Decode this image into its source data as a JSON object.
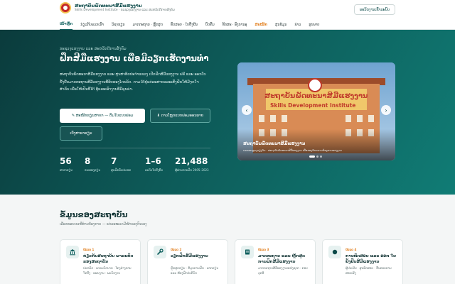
{
  "brand": {
    "title": "ສະຖາບັນພັດທະນາສີມືແຮງງານ",
    "subtitle": "Skills Development Institute · ກະຊວງແຮງງານ ແລະ ສະຫວັດດີການສັງຄົມ"
  },
  "header": {
    "login_label": "ພະນັກງານເຂົ້າລະບົບ"
  },
  "nav": {
    "items": [
      "ໜ້າຫຼັກ",
      "ກ່ຽວກັບພວກເຮົາ",
      "ວິຊາຮຽນ",
      "ມາດຕະຖານ · ຫຼັກສູດ",
      "ທົດສອບ · ໃບຢັ້ງຢືນ",
      "ບົດຄົ້ນ",
      "ທັກສະ · ອົງການອຸ",
      "ສະໝັກ",
      "ສູນຂໍ້ມູນ",
      "ຂ່າວ",
      "ຮູບພາບ"
    ]
  },
  "hero": {
    "eyebrow": "ກະຊວງແຮງງານ ແລະ ສະຫວັດດີການສັງຄົມ",
    "title": "ຝຶກສີມືແຮງງານ ເພື່ອມີວຽກເຮັດງານທຳ",
    "description": "ສະຖາບັນພັດທະນາສີມືແຮງງານ ແລະ ສູນສາທິດປະຈຳແຂວງ ເປີດຝຶກສີມືແຮງງານ ຟຣີ ແລະ ອອກໃບຢັ້ງຢືນມາດຕະຖານສີມືແຮງງານທີ່ຮັບຮອງໂດຍລັດ. ຕາມໄດ້ຢູ່ແຕ່ລະສາຍແລະເສັ່ງຝຶກໃຫ້ມີຈຸດໃຈສຳຄັນ ເພື່ອໃຫ້ເປັນທີ່ໄດ້ ຮູ້ແລະເອົາງານທີ່ມີຄຸນຄ່າ.",
    "primary_button": "✎ ສະໝັກຮຽນສາຂາ — ຕື່ມໃບແບບຟອມ",
    "secondary_button": "⬇ ດາວໂຫຼດແບບຟອມອອນລາຍ",
    "tertiary_button": "ເບິ່ງສາຂາຮຽນ"
  },
  "stats": [
    {
      "value": "56",
      "label": "ສາຂາຮຽນ"
    },
    {
      "value": "8",
      "label": "ຂະແໜງຮຽນ"
    },
    {
      "value": "7",
      "label": "ສູນຝຶກທົ່ວປະເທດ"
    },
    {
      "value": "1–6",
      "label": "ລະດັບໃບຢັ້ງຢືນ"
    },
    {
      "value": "21,488",
      "label": "ຜູ້ຜ່ານການຝຶກ 2005–2023"
    }
  ],
  "slider": {
    "sign_title": "ສະຖາບັນພັດທະນາສີມືແຮງງານ",
    "sign_subtitle": "Skills Development Institute",
    "caption_title": "ສະຖາບັນພັດທະນາສີມືແຮງງານ",
    "caption_sub": "ນະຄອນຫຼວງວຽງຈັນ · ສະຖາບັນພັດທະນາສີມືແຮງງານ ເພື່ອຮອງຮັບຄວາມຕ້ອງການແຮງງານ"
  },
  "section": {
    "title": "ຂໍ້ມູນຂອງສະຖາບັນ",
    "subtitle": "ເລືອກຂອບເຂດທີ່ທ່ານຕ້ອງການ — ແຕ່ລະໝວດມີໜ້າຂອງຕົນເອງ"
  },
  "cards": [
    {
      "num": "ໝວດ 1",
      "title": "ກ່ຽວກັບສະຖາບັນ ພາລະກິດຂອງສະຖາບັນ",
      "desc": "ປະຫວັດ · ພາລະບົດບາດ · ໂຄງຮ່າງການຈັດຕັ້ງ · ແຜນງານ · ພະນັກງານ",
      "icon": "institution-icon"
    },
    {
      "num": "ໝວດ 2",
      "title": "ວຽກຝຶກສີມືແຮງງານ",
      "desc": "ຫຼັກສູດຮຽນ · ຂໍ້ມູນການຝຶກ · ພາກຮຽນ ແລະ ຫ້ອງຝຶກປະຕິບັດ",
      "icon": "wrench-icon"
    },
    {
      "num": "ໝວດ 3",
      "title": "ມາດຕະຖານ ແລະ ຫຼັກສູດ ການຝຶກສີມືແຮງງານ",
      "desc": "ມາດຕະຖານສີມືແຮງງານແຫ່ງຊາດ · ກອບວຸດທິ",
      "icon": "book-icon"
    },
    {
      "num": "ໝວດ 4",
      "title": "ການທົດສອບ ແລະ ອອກ ໃບຢັ້ງຢືນສີມືແຮງງານ",
      "desc": "ຜູ້ປະເມີນ · ສູນທົດສອບ · ຂັ້ນຕອນການສອບເສັງ",
      "icon": "badge-icon"
    }
  ],
  "colors": {
    "hero_dark": "#0b3b3c",
    "hero_light": "#107c75",
    "accent_orange": "#e07a16",
    "brand_red": "#c62828"
  }
}
